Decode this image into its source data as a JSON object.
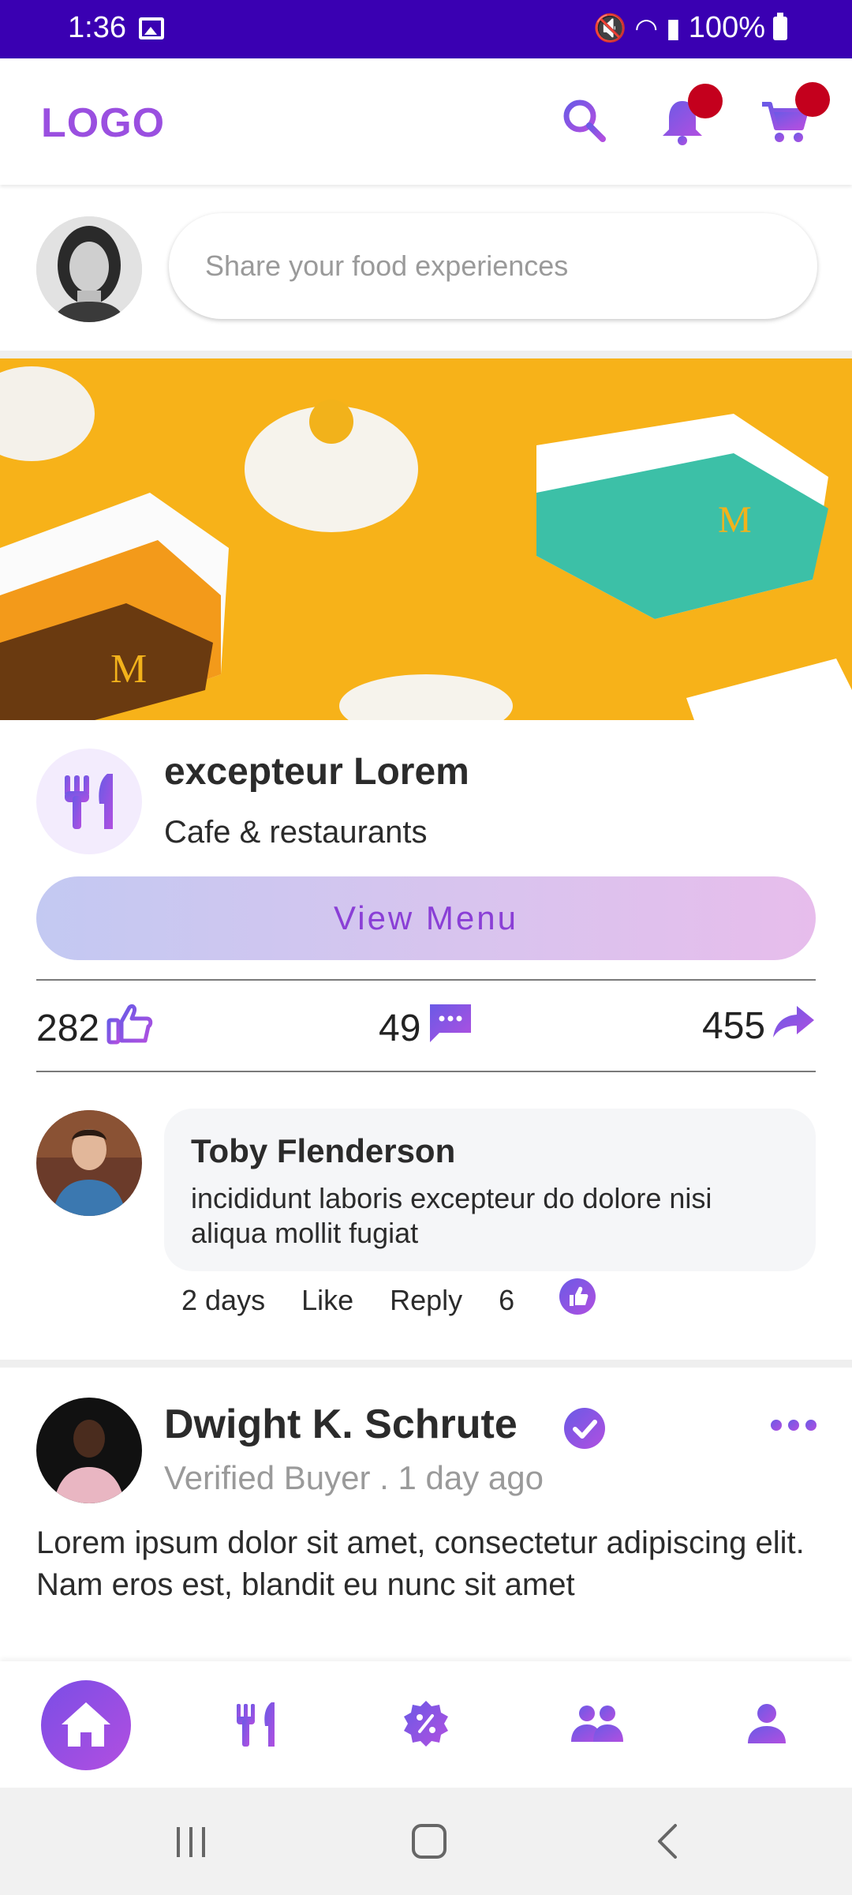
{
  "status_bar": {
    "time": "1:36",
    "battery": "100%"
  },
  "header": {
    "logo": "LOGO"
  },
  "composer": {
    "placeholder": "Share your food experiences"
  },
  "restaurant": {
    "name": "excepteur Lorem",
    "category": "Cafe & restaurants",
    "menu_button": "View Menu",
    "stats": {
      "likes": "282",
      "comments": "49",
      "shares": "455"
    }
  },
  "comment": {
    "author": "Toby Flenderson",
    "text": "incididunt laboris excepteur do dolore nisi aliqua mollit fugiat",
    "time": "2 days",
    "like_label": "Like",
    "reply_label": "Reply",
    "like_count": "6"
  },
  "post": {
    "author": "Dwight K. Schrute",
    "subtitle": "Verified Buyer . 1 day ago",
    "body": "Lorem ipsum dolor sit amet, consectetur adipiscing elit. Nam eros est, blandit eu nunc sit amet"
  },
  "colors": {
    "accent": "#9a4fe0",
    "status_bar": "#3a00b2",
    "badge": "#c4001d",
    "banner": "#f8b31b"
  },
  "icons": [
    "search-icon",
    "bell-icon",
    "cart-icon",
    "cutlery-icon",
    "thumbs-up-icon",
    "comment-icon",
    "share-icon",
    "verified-icon",
    "more-icon",
    "home-icon",
    "discount-icon",
    "group-icon",
    "person-icon"
  ]
}
